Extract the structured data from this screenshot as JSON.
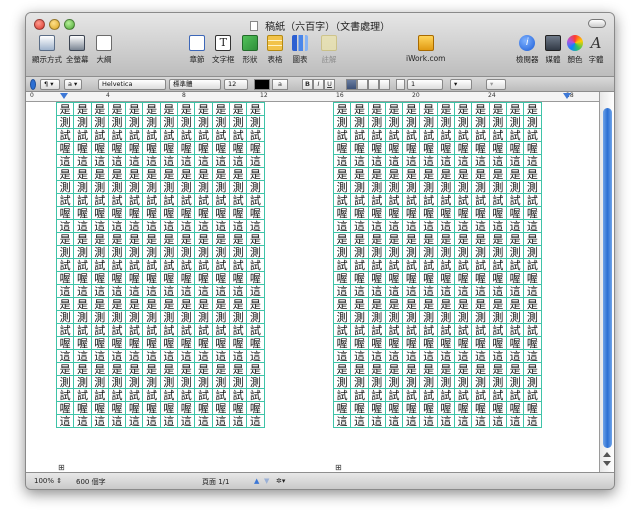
{
  "window": {
    "title": "稿紙（六百字）（文書處理）"
  },
  "toolbar": {
    "left": [
      {
        "label": "顯示方式",
        "icon": "view-icon"
      },
      {
        "label": "全螢幕",
        "icon": "fullscreen-icon"
      },
      {
        "label": "大綱",
        "icon": "outline-icon"
      }
    ],
    "center": [
      {
        "label": "章節",
        "icon": "section-icon"
      },
      {
        "label": "文字框",
        "icon": "textbox-icon"
      },
      {
        "label": "形狀",
        "icon": "shapes-icon"
      },
      {
        "label": "表格",
        "icon": "table-icon"
      },
      {
        "label": "圖表",
        "icon": "chart-icon"
      },
      {
        "label": "註解",
        "icon": "comment-icon"
      }
    ],
    "iwork": {
      "label": "iWork.com",
      "icon": "iwork-icon"
    },
    "right": [
      {
        "label": "檢閱器",
        "icon": "inspector-icon"
      },
      {
        "label": "媒體",
        "icon": "media-icon"
      },
      {
        "label": "顏色",
        "icon": "colors-icon"
      },
      {
        "label": "字體",
        "icon": "fonts-icon"
      }
    ]
  },
  "format_bar": {
    "style_btn": "¶ ▾",
    "a_btn": "a ▾",
    "font_family": "Helvetica",
    "font_face": "標準體",
    "font_size": "12",
    "text_color_swatch": "#000000",
    "highlight_label": "a",
    "bold": "B",
    "italic": "I",
    "underline": "U",
    "spacing": "1",
    "columns_label": "▾",
    "list_label": "▾"
  },
  "ruler": {
    "labels": [
      "0",
      "4",
      "8",
      "12",
      "16",
      "20",
      "24",
      "28"
    ]
  },
  "document": {
    "columns": [
      "是",
      "測",
      "試",
      "喔",
      "這"
    ],
    "rows_per_page": 25,
    "cols_per_page": 12
  },
  "statusbar": {
    "zoom": "100%",
    "word_count": "600 個字",
    "page_info": "頁面 1/1"
  },
  "colors": {
    "grid_line": "#3fc3a8",
    "scroll_thumb": "#2b6fd3"
  }
}
